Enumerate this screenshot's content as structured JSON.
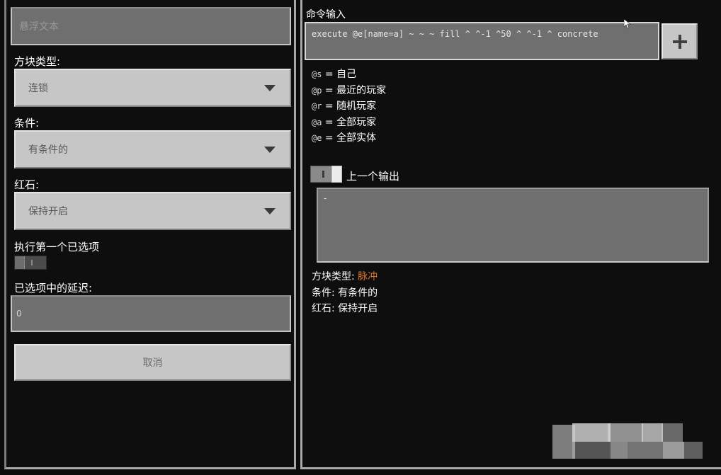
{
  "left": {
    "hover_text_placeholder": "悬浮文本",
    "block_type": {
      "label": "方块类型:",
      "value": "连锁"
    },
    "condition": {
      "label": "条件:",
      "value": "有条件的"
    },
    "redstone": {
      "label": "红石:",
      "value": "保持开启"
    },
    "execute_first": {
      "label": "执行第一个已选项"
    },
    "delay": {
      "label": "已选项中的延迟:",
      "value": "0"
    },
    "cancel_label": "取消"
  },
  "right": {
    "command_label": "命令输入",
    "command_value": "execute @e[name=a] ~ ~ ~ fill ^ ^-1 ^50 ^ ^-1 ^ concrete",
    "selectors": [
      {
        "code": "@s",
        "desc": "= 自己"
      },
      {
        "code": "@p",
        "desc": "= 最近的玩家"
      },
      {
        "code": "@r",
        "desc": "= 随机玩家"
      },
      {
        "code": "@a",
        "desc": "= 全部玩家"
      },
      {
        "code": "@e",
        "desc": "= 全部实体"
      }
    ],
    "previous_output_label": "上一个输出",
    "output_text": "-",
    "status": {
      "block_type_label": "方块类型:",
      "block_type_value": "脉冲",
      "condition_line": "条件: 有条件的",
      "redstone_line": "红石: 保持开启"
    }
  },
  "colors": {
    "accent": "#e0752b",
    "button_face": "#c6c6c6",
    "field_bg": "#6f6f6f",
    "background": "#0e0e0e"
  },
  "icons": [
    "chevron-down-icon",
    "plus-icon",
    "cursor-icon"
  ]
}
